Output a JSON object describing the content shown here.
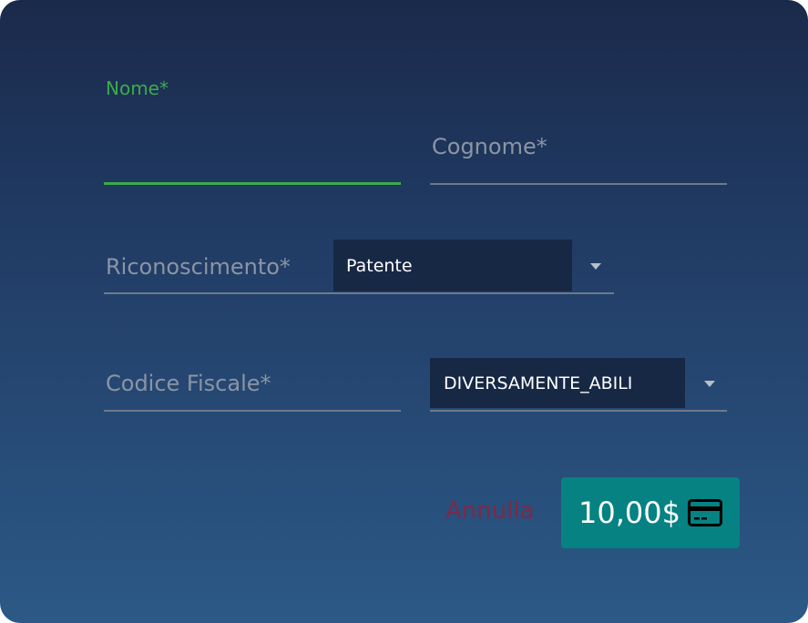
{
  "form": {
    "nome_label": "Nome*",
    "cognome_placeholder": "Cognome*",
    "riconoscimento_placeholder": "Riconoscimento*",
    "riconoscimento_value": "Patente",
    "codice_fiscale_placeholder": "Codice Fiscale*",
    "categoria_value": "DIVERSAMENTE_ABILI"
  },
  "actions": {
    "cancel_label": "Annulla",
    "pay_amount": "10,00$"
  },
  "colors": {
    "background_top": "#1a2a4b",
    "background_bottom": "#2c5986",
    "focus_accent": "#3daa4a",
    "pay_button": "#068283",
    "cancel_text": "#7a2a4a",
    "select_bg": "#172845"
  },
  "icons": {
    "pay_icon": "credit-card-icon",
    "dropdown_icon": "chevron-down-icon"
  }
}
